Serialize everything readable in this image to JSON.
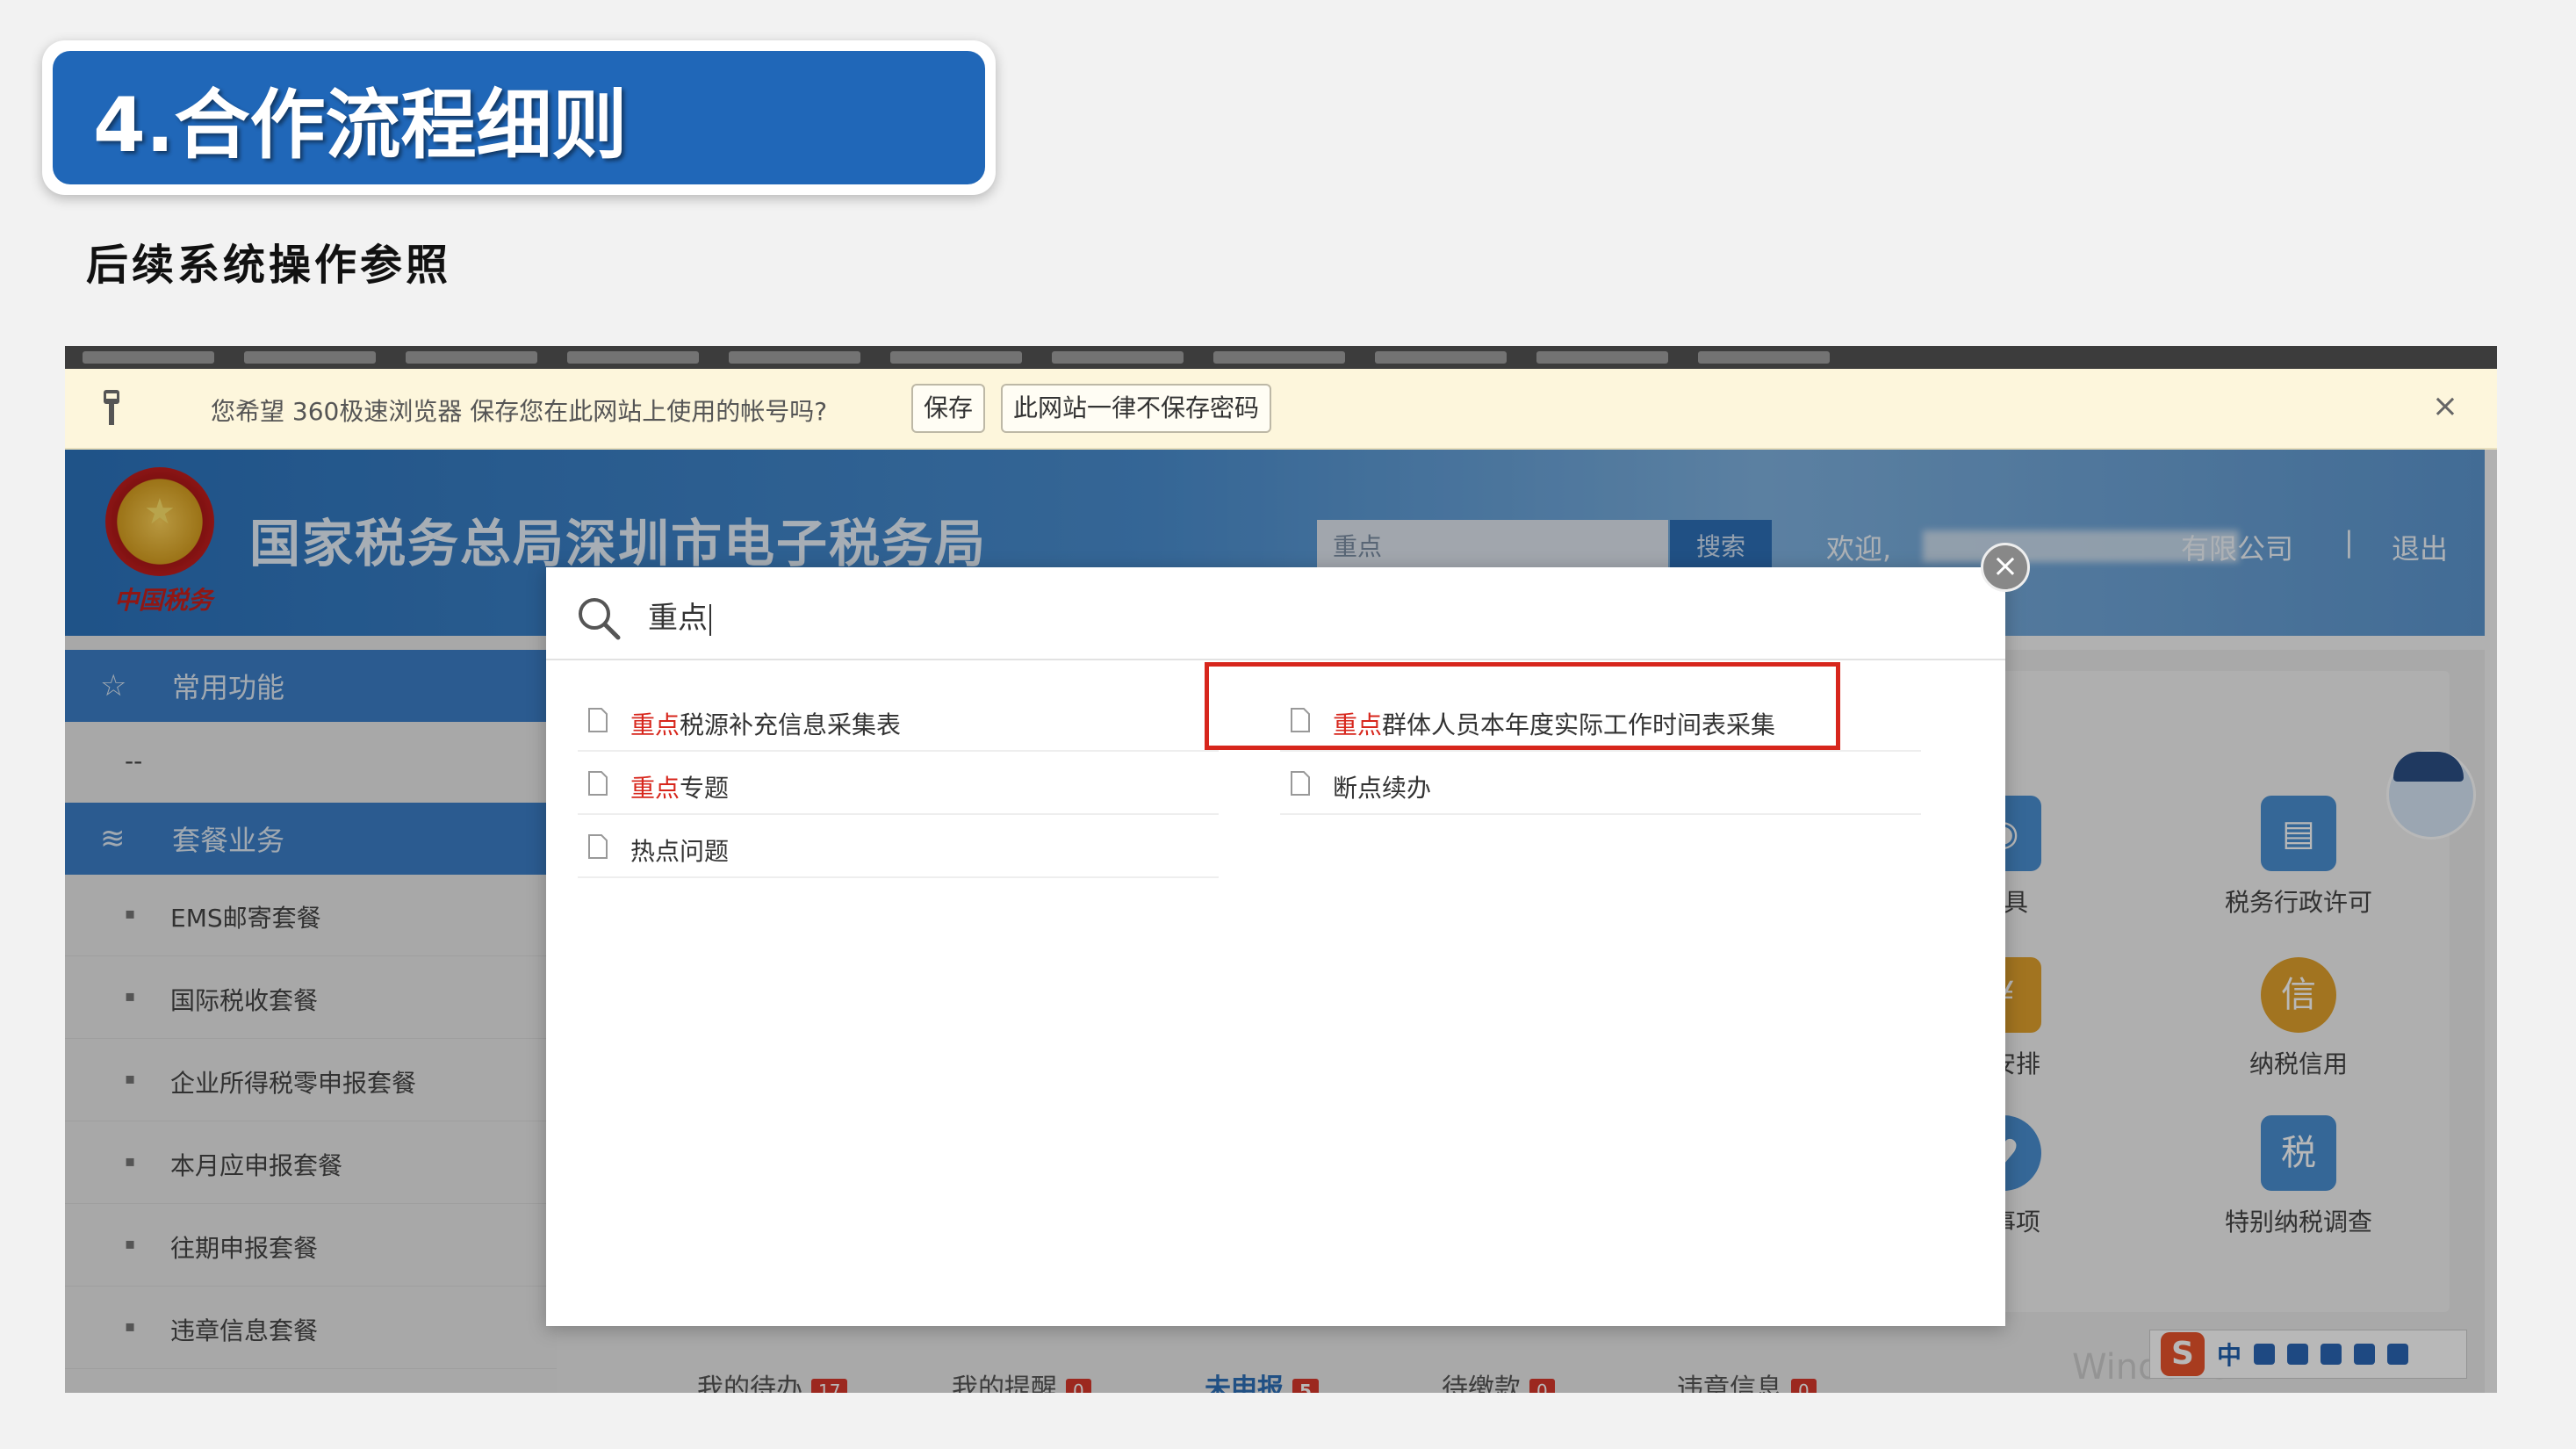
{
  "slide": {
    "title": "4.合作流程细则",
    "subtitle": "后续系统操作参照"
  },
  "browser": {
    "password_bar": {
      "message": "您希望 360极速浏览器 保存您在此网站上使用的帐号吗?",
      "save_button": "保存",
      "never_button": "此网站一律不保存密码",
      "close": "×"
    }
  },
  "site": {
    "emblem_sign": "中国税务",
    "title": "国家税务总局深圳市电子税务局",
    "search_value": "重点",
    "search_button": "搜索",
    "welcome": "欢迎,",
    "company_suffix": "有限公司",
    "separator": "|",
    "logout": "退出"
  },
  "sidebar": {
    "common_label": "常用功能",
    "common_placeholder": "--",
    "package_label": "套餐业务",
    "items": [
      {
        "label": "EMS邮寄套餐"
      },
      {
        "label": "国际税收套餐"
      },
      {
        "label": "企业所得税零申报套餐"
      },
      {
        "label": "本月应申报套餐"
      },
      {
        "label": "往期申报套餐"
      },
      {
        "label": "违章信息套餐"
      }
    ],
    "bullet": "▪"
  },
  "services": [
    {
      "label": "税务行政许可",
      "icon": "certificate-icon"
    },
    {
      "label": "纳税信用",
      "icon": "credit-icon",
      "glyph": "信"
    },
    {
      "label": "特别纳税调查",
      "icon": "tax-form-icon",
      "glyph": "税"
    },
    {
      "label": "开具",
      "icon": "invoice-icon"
    },
    {
      "label": "价安排",
      "icon": "calendar-icon"
    },
    {
      "label": "务事项",
      "icon": "heart-icon"
    }
  ],
  "tabs": [
    {
      "label": "我的待办",
      "badge": "17"
    },
    {
      "label": "我的提醒",
      "badge": "0"
    },
    {
      "label": "未申报",
      "badge": "5"
    },
    {
      "label": "待缴款",
      "badge": "0"
    },
    {
      "label": "违章信息",
      "badge": "0"
    }
  ],
  "ime": {
    "logo": "S",
    "mode": "中"
  },
  "popup": {
    "query": "重点",
    "close": "×",
    "results_left": [
      {
        "highlight": "重点",
        "rest": "税源补充信息采集表"
      },
      {
        "highlight": "重点",
        "rest": "专题"
      },
      {
        "highlight": "",
        "rest": "热点问题"
      }
    ],
    "results_right": [
      {
        "highlight": "重点",
        "rest": "群体人员本年度实际工作时间表采集"
      },
      {
        "highlight": "",
        "rest": "断点续办"
      }
    ]
  },
  "colors": {
    "title_blue": "#2067b8",
    "highlight_red": "#d7261c",
    "header_blue": "#2b73bd"
  }
}
